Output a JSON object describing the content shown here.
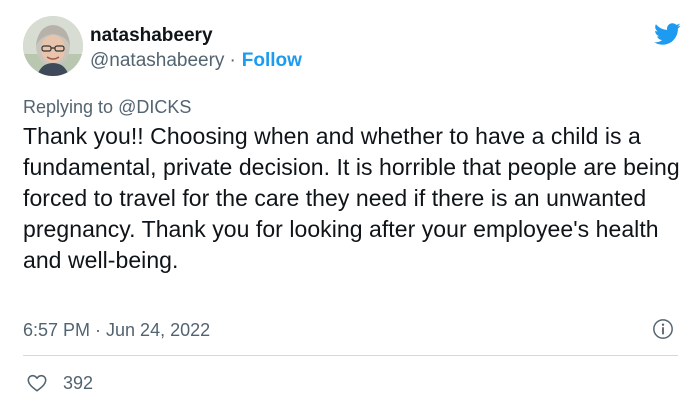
{
  "author": {
    "display_name": "natashabeery",
    "handle": "@natashabeery",
    "separator": "·",
    "follow_label": "Follow"
  },
  "reply": {
    "prefix": "Replying to ",
    "mention": "@DICKS"
  },
  "tweet": {
    "text": "Thank you!! Choosing when and whether to have a child is a fundamental, private decision. It is horrible that people are being forced to travel for the care they need if there is an unwanted pregnancy. Thank you for looking after your employee's health and well-being.",
    "timestamp": "6:57 PM · Jun 24, 2022"
  },
  "stats": {
    "likes": "392"
  },
  "icons": {
    "brand": "twitter-bird-icon",
    "info": "info-icon",
    "like": "heart-icon"
  },
  "colors": {
    "accent": "#1d9bf0",
    "secondary_text": "#536471",
    "primary_text": "#0f1419",
    "divider": "#cfd9de"
  }
}
